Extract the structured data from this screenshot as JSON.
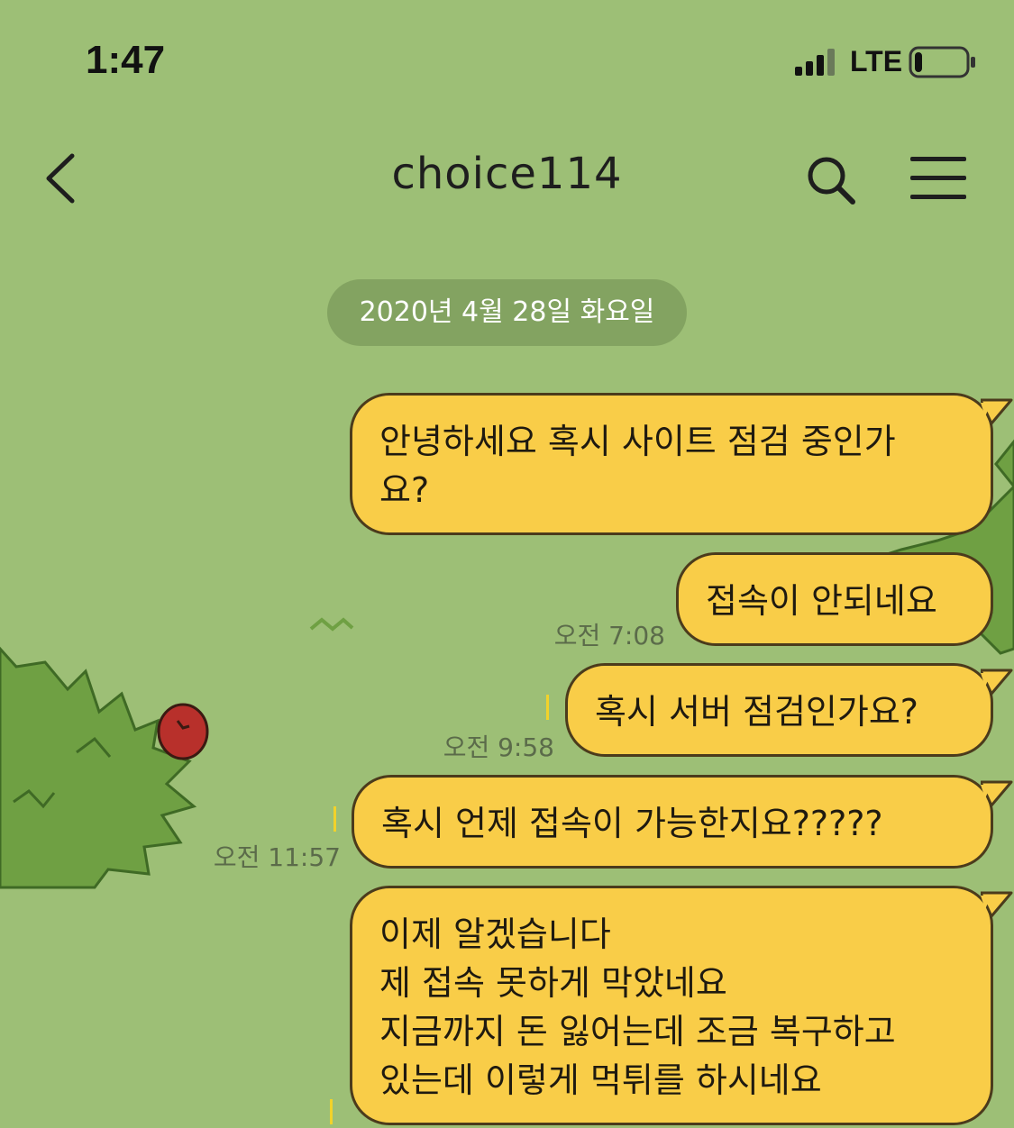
{
  "status_bar": {
    "time": "1:47",
    "network": "LTE",
    "battery_level": 0.15
  },
  "header": {
    "title": "choice114",
    "back_icon": "chevron-left-icon",
    "search_icon": "search-icon",
    "menu_icon": "hamburger-menu-icon"
  },
  "chat": {
    "date_separator": "2020년 4월 28일 화요일",
    "messages": [
      {
        "text": "안녕하세요 혹시 사이트 점검 중인가\n요?",
        "time": ""
      },
      {
        "text": "접속이 안되네요",
        "time": "오전 7:08"
      },
      {
        "text": "혹시 서버 점검인가요?",
        "time": "오전 9:58"
      },
      {
        "text": "혹시 언제 접속이 가능한지요?????",
        "time": "오전 11:57"
      },
      {
        "text": "이제 알겠습니다\n제 접속 못하게 막았네요\n지금까지 돈 잃어는데 조금 복구하고\n있는데 이렇게 먹튀를 하시네요",
        "time": ""
      }
    ]
  },
  "colors": {
    "background": "#9dbf76",
    "bubble": "#f9cd48",
    "bubble_border": "#4b3b1c",
    "bush": "#6fa043"
  }
}
